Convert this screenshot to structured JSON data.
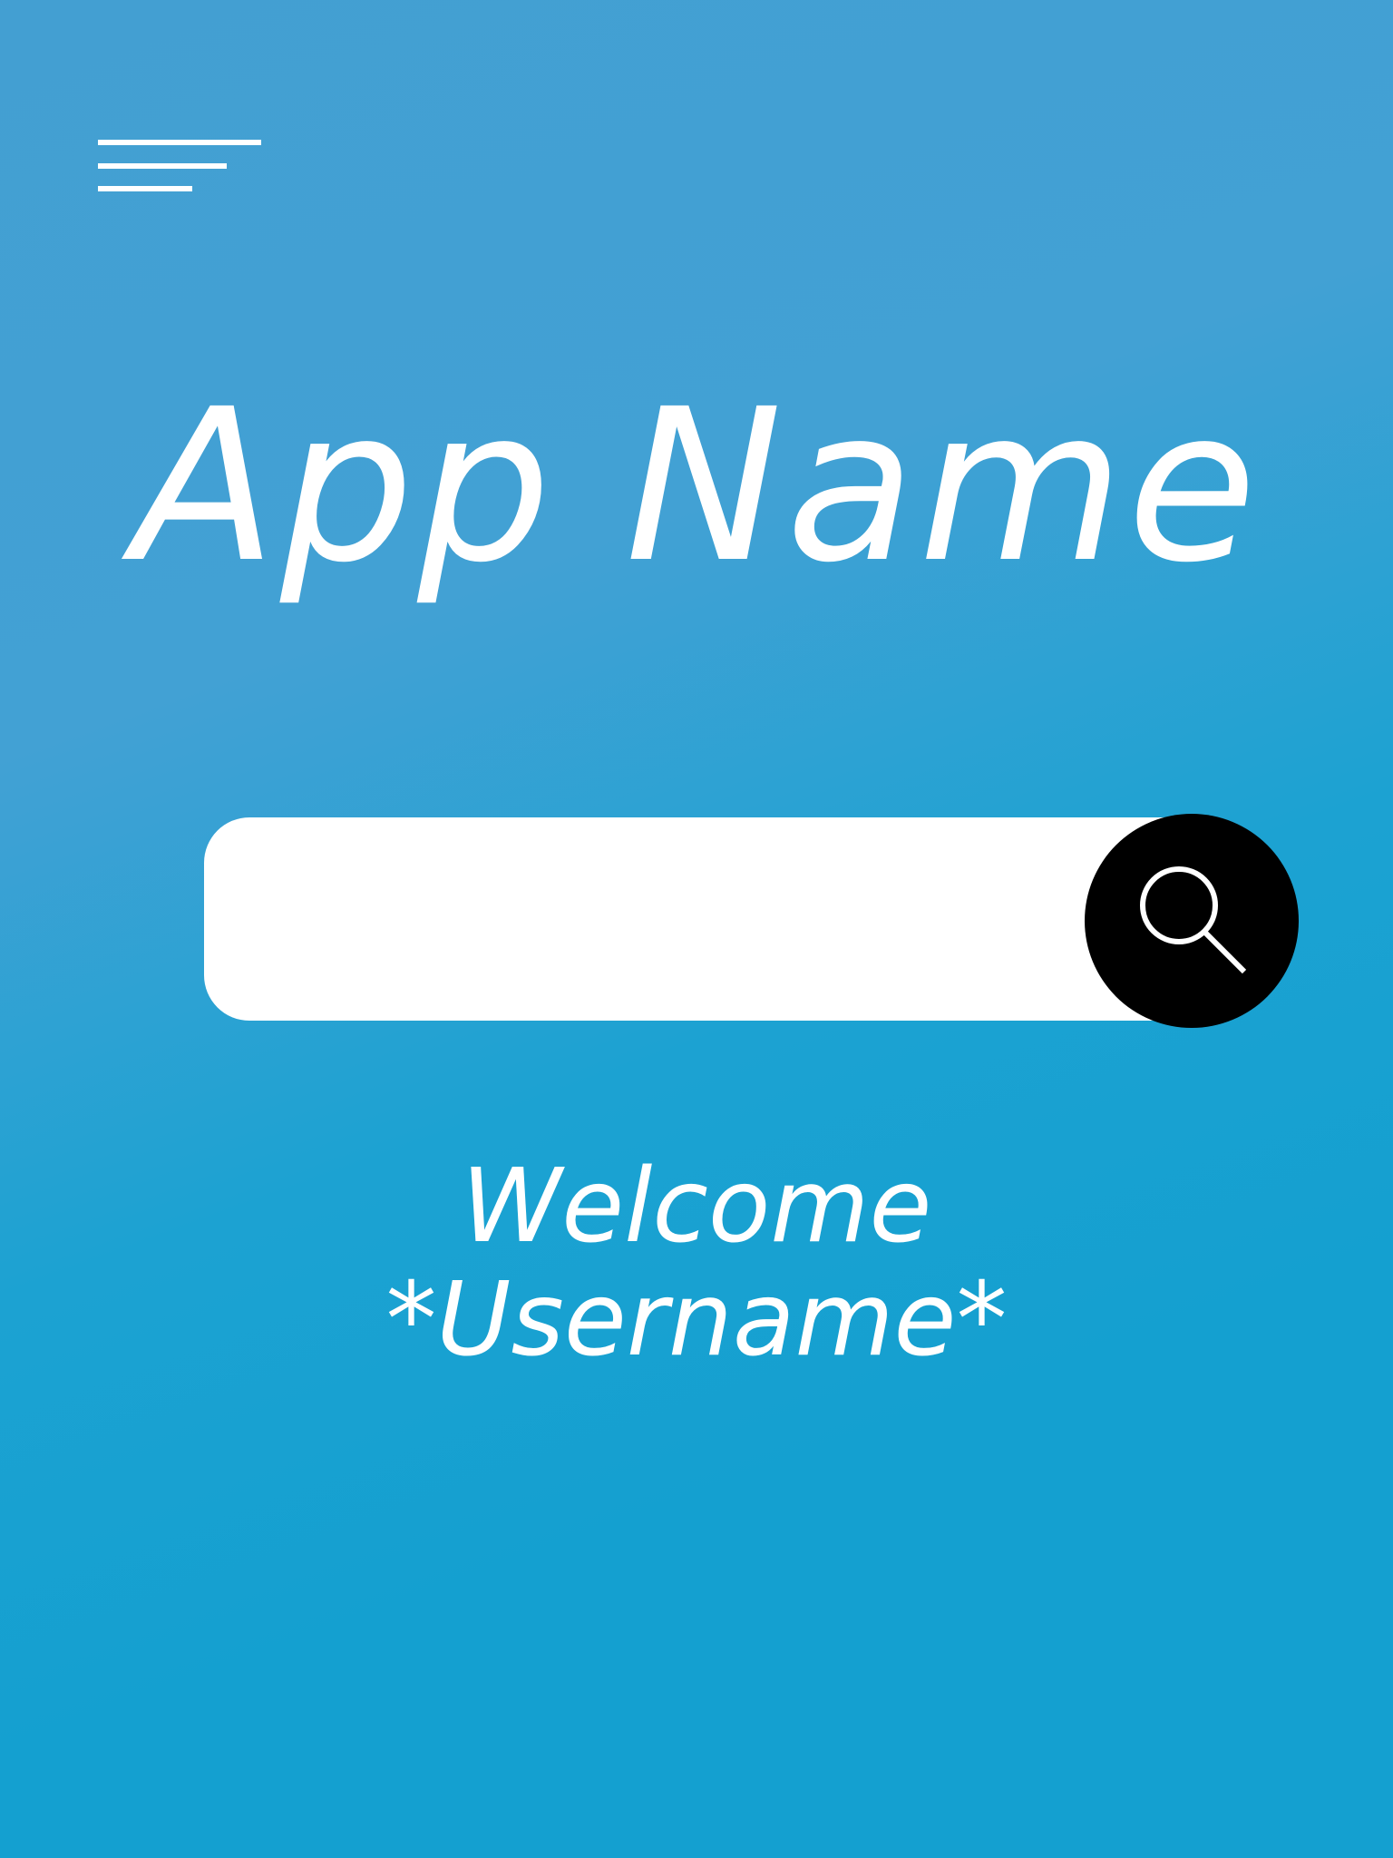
{
  "header": {
    "menu_icon": "hamburger-menu-icon"
  },
  "app": {
    "title": "App Name"
  },
  "search": {
    "value": "",
    "placeholder": "",
    "button_icon": "search-icon"
  },
  "welcome": {
    "greeting": "Welcome",
    "username": "*Username*"
  },
  "colors": {
    "background_top": "#439fd2",
    "background_bottom": "#14a0d0",
    "text": "#ffffff",
    "search_field": "#ffffff",
    "search_button": "#000000"
  }
}
